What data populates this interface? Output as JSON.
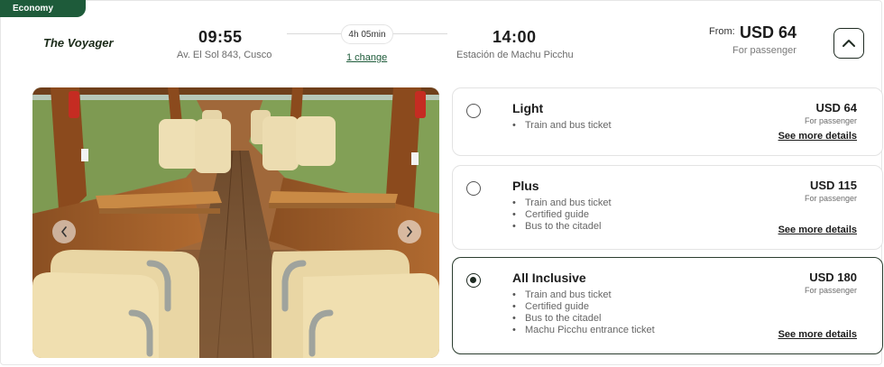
{
  "badge": "Economy",
  "train_name": "The Voyager",
  "departure": {
    "time": "09:55",
    "station": "Av. El Sol 843, Cusco"
  },
  "duration": "4h 05min",
  "changes": "1 change",
  "arrival": {
    "time": "14:00",
    "station": "Estación de Machu Picchu"
  },
  "price_summary": {
    "from_label": "From:",
    "price": "USD 64",
    "sub": "For passenger"
  },
  "icons": {
    "collapse": "chevron-up-icon",
    "prev": "chevron-left-icon",
    "next": "chevron-right-icon"
  },
  "accent_color": "#1e5b3a",
  "fares": [
    {
      "name": "Light",
      "price": "USD 64",
      "sub": "For passenger",
      "features": [
        "Train and bus ticket"
      ],
      "details": "See more details",
      "selected": false
    },
    {
      "name": "Plus",
      "price": "USD 115",
      "sub": "For passenger",
      "features": [
        "Train and bus ticket",
        "Certified guide",
        "Bus to the citadel"
      ],
      "details": "See more details",
      "selected": false
    },
    {
      "name": "All Inclusive",
      "price": "USD 180",
      "sub": "For passenger",
      "features": [
        "Train and bus ticket",
        "Certified guide",
        "Bus to the citadel",
        "Machu Picchu entrance ticket"
      ],
      "details": "See more details",
      "selected": true
    }
  ]
}
